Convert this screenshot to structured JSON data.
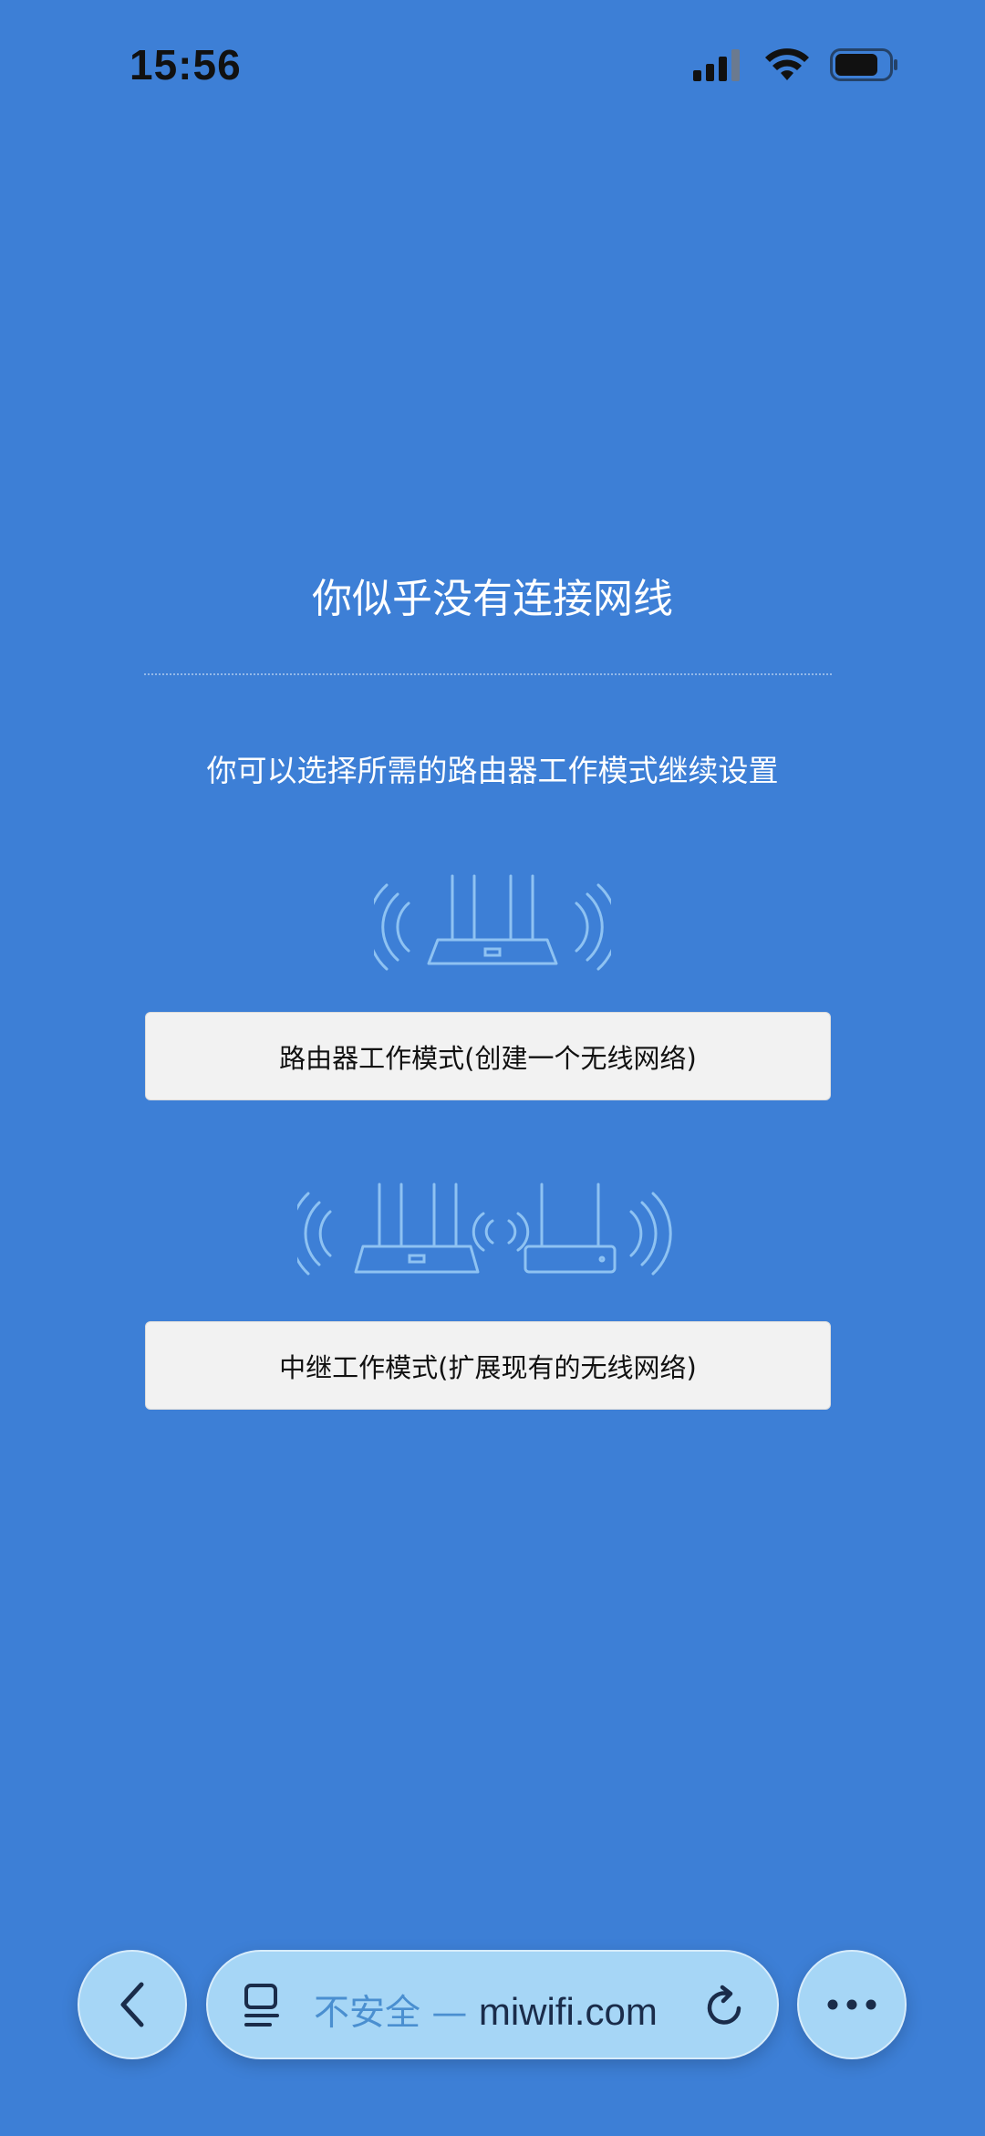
{
  "status_bar": {
    "time": "15:56",
    "icons": [
      "cellular-signal-icon",
      "wifi-icon",
      "battery-icon"
    ]
  },
  "page": {
    "title": "你似乎没有连接网线",
    "subtitle": "你可以选择所需的路由器工作模式继续设置",
    "router_mode_button": "路由器工作模式(创建一个无线网络)",
    "repeater_mode_button": "中继工作模式(扩展现有的无线网络)",
    "background_color": "#3d7fd6"
  },
  "browser_bar": {
    "back_icon": "chevron-left-icon",
    "reader_icon": "reader-icon",
    "security_label": "不安全",
    "separator": "—",
    "domain": "miwifi.com",
    "reload_icon": "reload-icon",
    "more_icon": "more-icon"
  }
}
